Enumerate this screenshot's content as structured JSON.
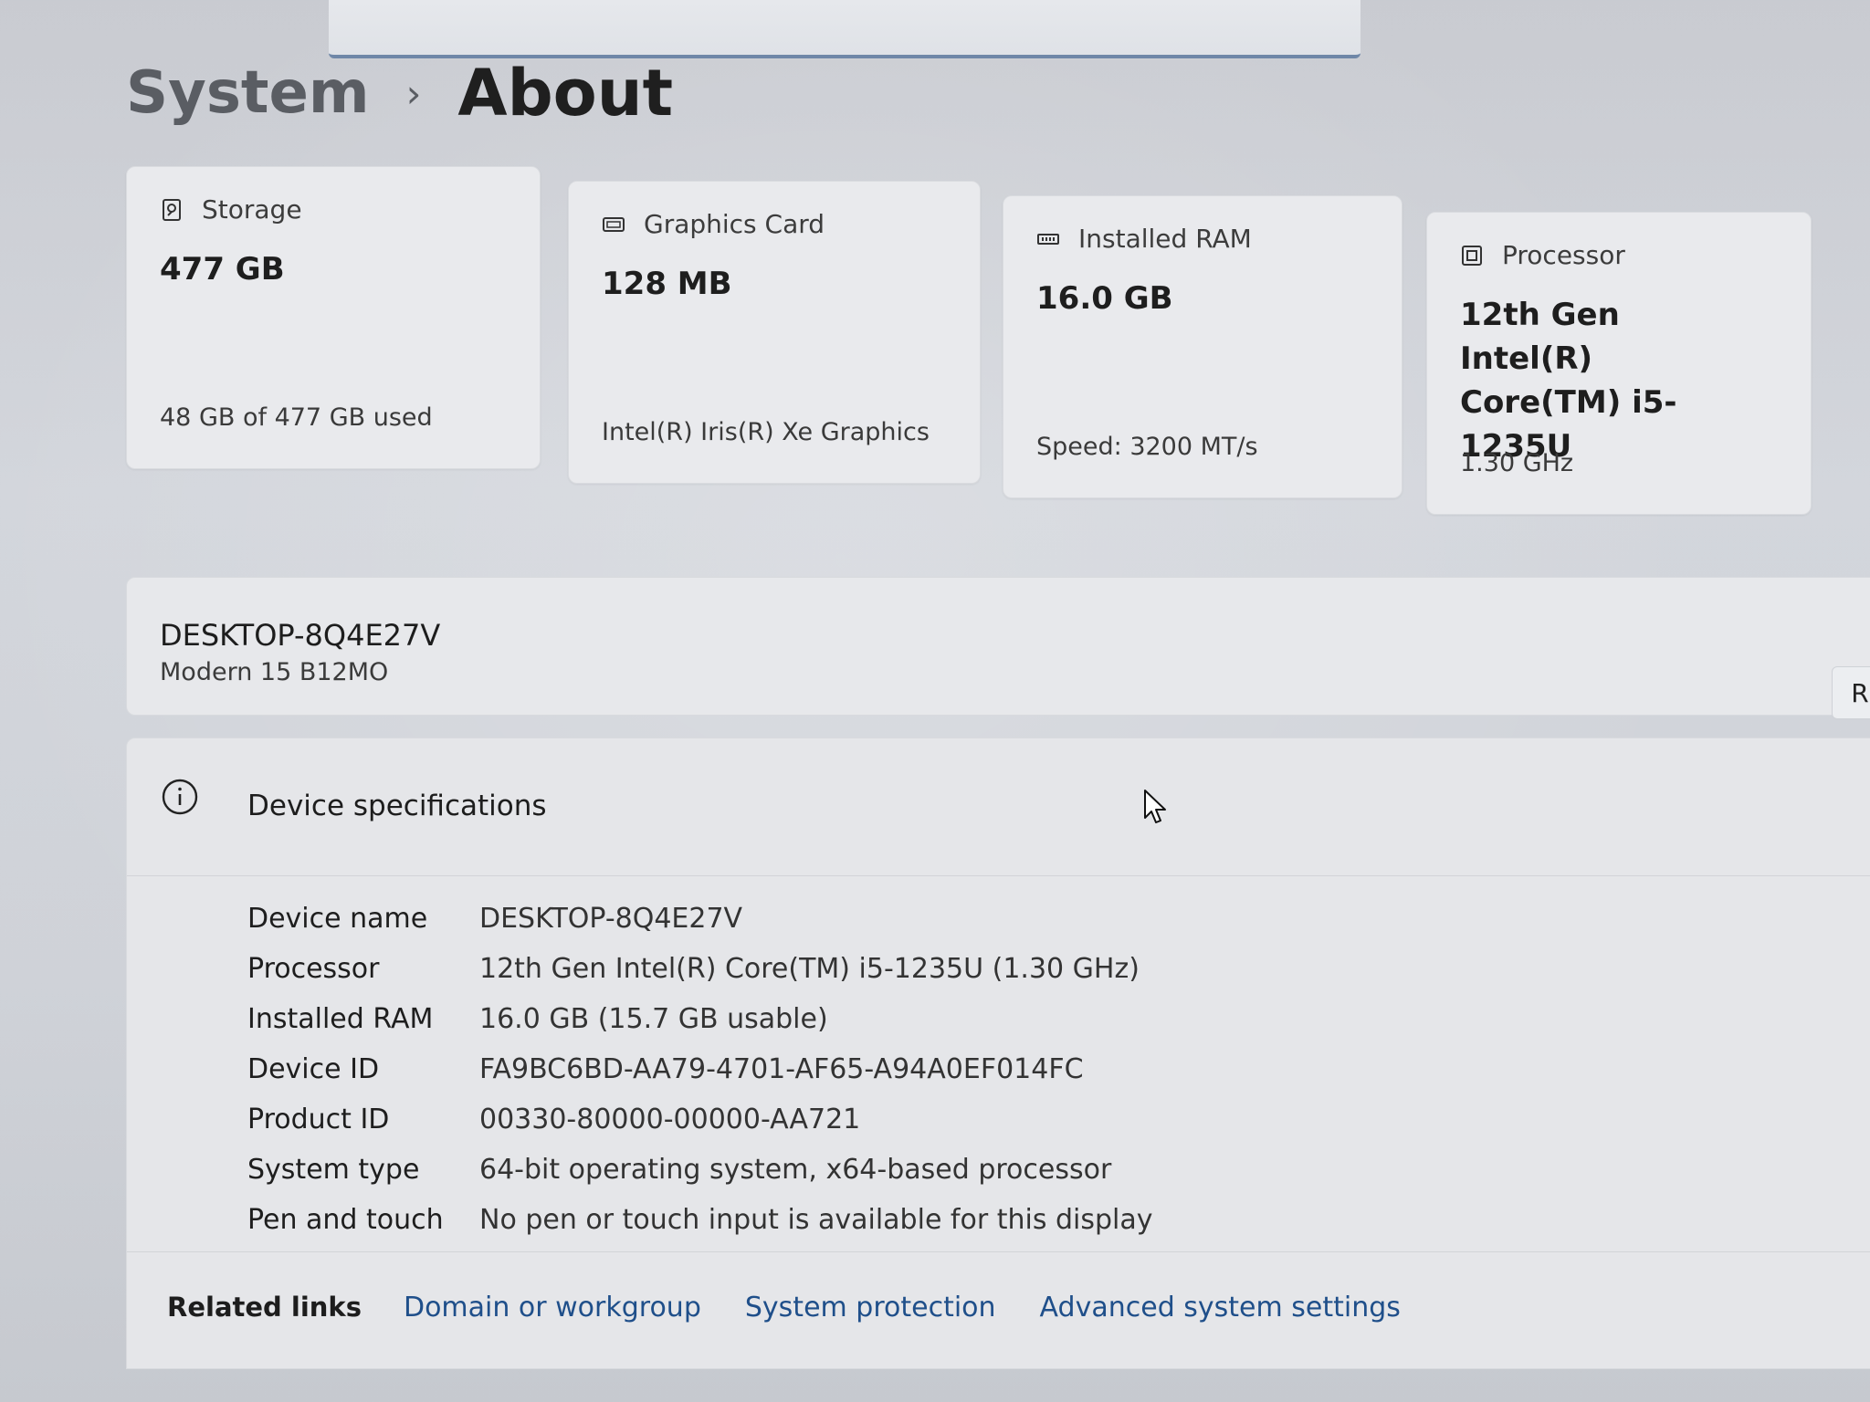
{
  "breadcrumb": {
    "parent": "System",
    "separator": "›",
    "current": "About"
  },
  "cards": [
    {
      "icon": "storage-icon",
      "title": "Storage",
      "value": "477 GB",
      "subtitle": "48 GB of 477 GB used"
    },
    {
      "icon": "graphics-card-icon",
      "title": "Graphics Card",
      "value": "128 MB",
      "subtitle": "Intel(R) Iris(R) Xe Graphics"
    },
    {
      "icon": "ram-icon",
      "title": "Installed RAM",
      "value": "16.0 GB",
      "subtitle": "Speed: 3200 MT/s"
    },
    {
      "icon": "processor-icon",
      "title": "Processor",
      "value": "12th Gen Intel(R) Core(TM) i5-1235U",
      "subtitle": "1.30 GHz"
    }
  ],
  "device": {
    "name": "DESKTOP-8Q4E27V",
    "model": "Modern 15 B12MO",
    "rename_button_partial": "R"
  },
  "specs": {
    "title": "Device specifications",
    "rows": [
      {
        "label": "Device name",
        "value": "DESKTOP-8Q4E27V"
      },
      {
        "label": "Processor",
        "value": "12th Gen Intel(R) Core(TM) i5-1235U (1.30 GHz)"
      },
      {
        "label": "Installed RAM",
        "value": "16.0 GB (15.7 GB usable)"
      },
      {
        "label": "Device ID",
        "value": "FA9BC6BD-AA79-4701-AF65-A94A0EF014FC"
      },
      {
        "label": "Product ID",
        "value": "00330-80000-00000-AA721"
      },
      {
        "label": "System type",
        "value": "64-bit operating system, x64-based processor"
      },
      {
        "label": "Pen and touch",
        "value": "No pen or touch input is available for this display"
      }
    ]
  },
  "related": {
    "label": "Related links",
    "links": [
      "Domain or workgroup",
      "System protection",
      "Advanced system settings"
    ]
  },
  "colors": {
    "link": "#1f4f8a",
    "card_bg": "#e9eaed",
    "accent_bar": "#6f87a8"
  }
}
